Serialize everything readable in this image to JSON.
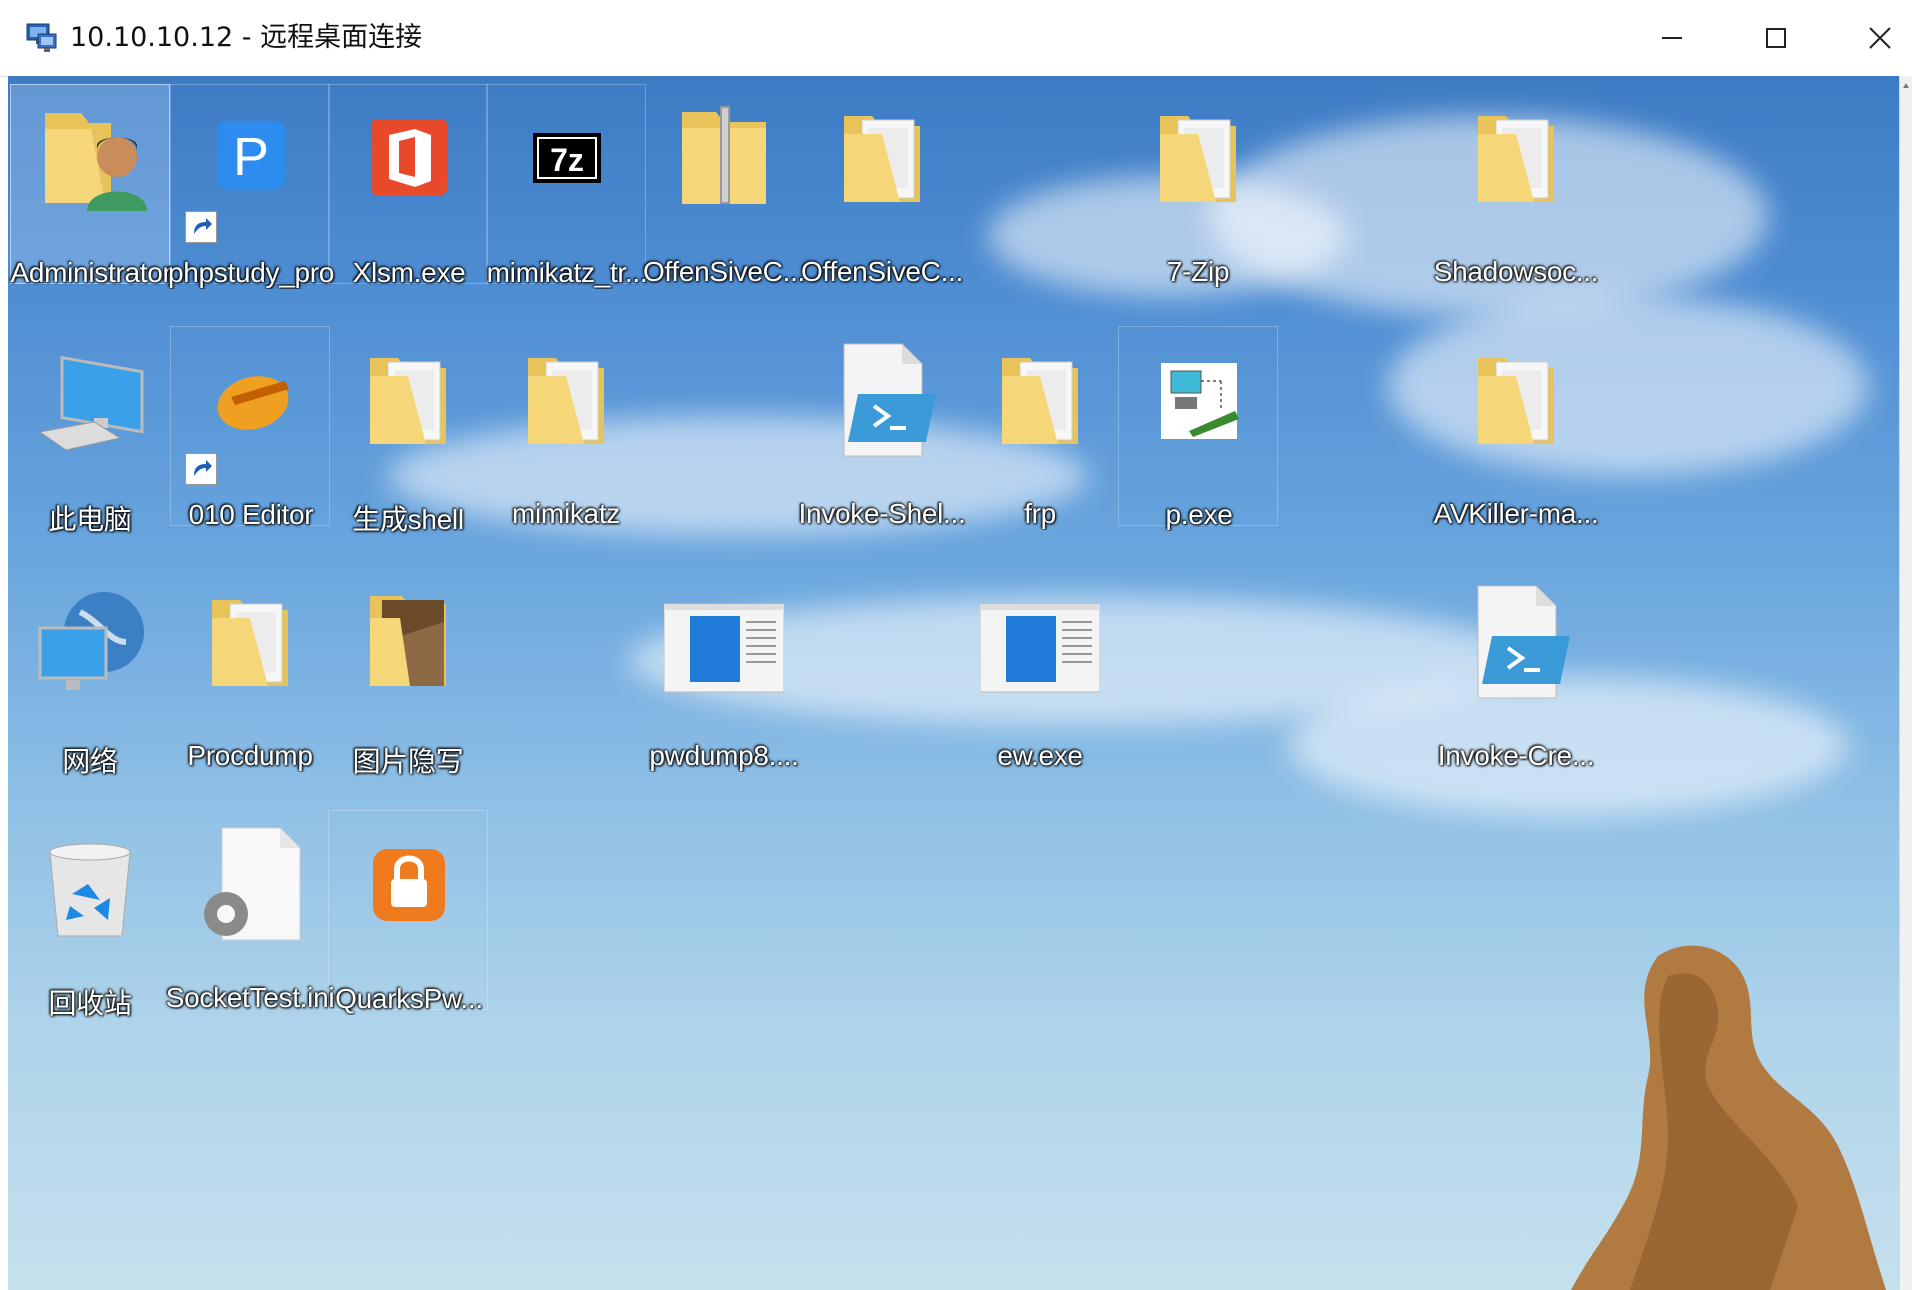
{
  "window": {
    "title": "10.10.10.12 - 远程桌面连接",
    "controls": {
      "minimize": "minimize",
      "maximize": "maximize",
      "close": "close"
    }
  },
  "desktop": {
    "icons": [
      {
        "label": "Administrator",
        "icon": "user-folder-icon"
      },
      {
        "label": "phpstudy_pro",
        "icon": "phpstudy-icon",
        "shortcut": true
      },
      {
        "label": "Xlsm.exe",
        "icon": "office-icon"
      },
      {
        "label": "mimikatz_tr...",
        "icon": "7zip-archive-icon"
      },
      {
        "label": "OffenSiveC...",
        "icon": "zip-folder-icon"
      },
      {
        "label": "OffenSiveC...",
        "icon": "folder-icon"
      },
      {
        "label": "7-Zip",
        "icon": "folder-icon"
      },
      {
        "label": "Shadowsoc...",
        "icon": "folder-icon"
      },
      {
        "label": "此电脑",
        "icon": "computer-icon"
      },
      {
        "label": "010 Editor",
        "icon": "010-editor-icon",
        "shortcut": true
      },
      {
        "label": "生成shell",
        "icon": "folder-icon"
      },
      {
        "label": "mimikatz",
        "icon": "folder-icon"
      },
      {
        "label": "Invoke-Shel...",
        "icon": "powershell-script-icon"
      },
      {
        "label": "frp",
        "icon": "folder-icon"
      },
      {
        "label": "p.exe",
        "icon": "network-app-icon"
      },
      {
        "label": "AVKiller-ma...",
        "icon": "folder-icon"
      },
      {
        "label": "网络",
        "icon": "network-globe-icon"
      },
      {
        "label": "Procdump",
        "icon": "folder-icon"
      },
      {
        "label": "图片隐写",
        "icon": "photo-folder-icon"
      },
      {
        "label": "pwdump8....",
        "icon": "exe-window-icon"
      },
      {
        "label": "ew.exe",
        "icon": "exe-window-icon"
      },
      {
        "label": "Invoke-Cre...",
        "icon": "powershell-script-icon"
      },
      {
        "label": "回收站",
        "icon": "recycle-bin-icon"
      },
      {
        "label": "SocketTest.ini",
        "icon": "config-file-icon"
      },
      {
        "label": "QuarksPw...",
        "icon": "lock-app-icon"
      }
    ]
  }
}
